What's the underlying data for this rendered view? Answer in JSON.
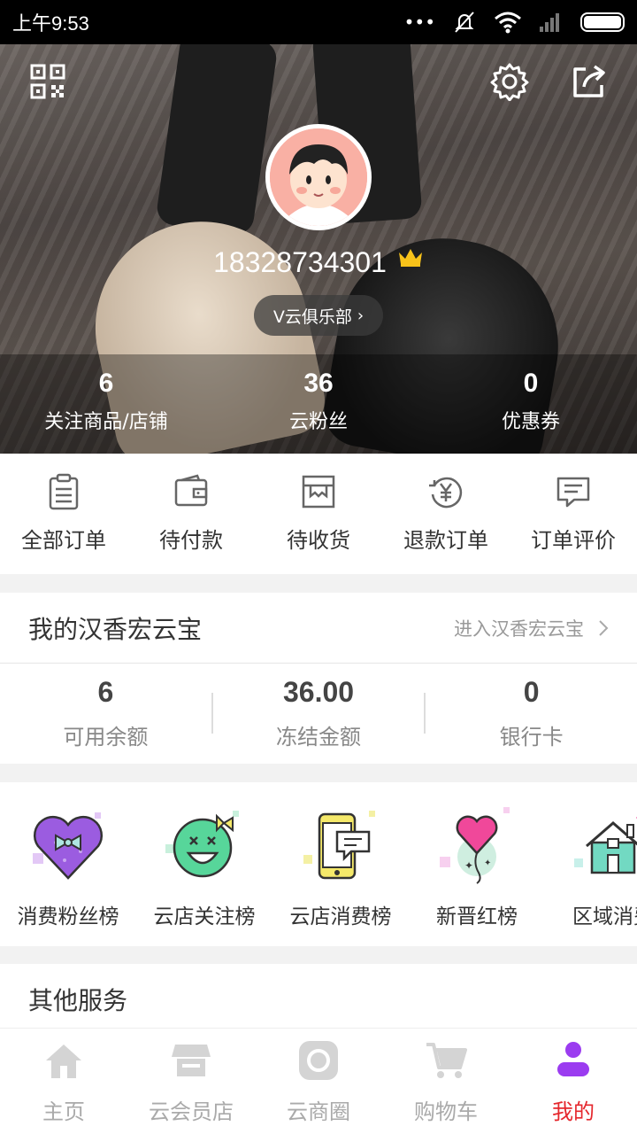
{
  "status_bar": {
    "time": "上午9:53",
    "dots": "•••"
  },
  "profile": {
    "phone": "18328734301",
    "club_label": "V云俱乐部",
    "stats": [
      {
        "value": "6",
        "label": "关注商品/店铺"
      },
      {
        "value": "36",
        "label": "云粉丝"
      },
      {
        "value": "0",
        "label": "优惠券"
      }
    ]
  },
  "orders": [
    {
      "label": "全部订单",
      "icon": "clipboard-icon"
    },
    {
      "label": "待付款",
      "icon": "wallet-icon"
    },
    {
      "label": "待收货",
      "icon": "box-icon"
    },
    {
      "label": "退款订单",
      "icon": "yen-refund-icon"
    },
    {
      "label": "订单评价",
      "icon": "comment-icon"
    }
  ],
  "wallet": {
    "title": "我的汉香宏云宝",
    "enter_label": "进入汉香宏云宝",
    "stats": [
      {
        "value": "6",
        "label": "可用余额"
      },
      {
        "value": "36.00",
        "label": "冻结金额"
      },
      {
        "value": "0",
        "label": "银行卡"
      }
    ]
  },
  "ranks": [
    {
      "label": "消费粉丝榜",
      "icon": "heart-bow-icon"
    },
    {
      "label": "云店关注榜",
      "icon": "smiley-icon"
    },
    {
      "label": "云店消费榜",
      "icon": "phone-chat-icon"
    },
    {
      "label": "新晋红榜",
      "icon": "balloon-icon"
    },
    {
      "label": "区域消费",
      "icon": "house-icon"
    }
  ],
  "other_services": {
    "title": "其他服务"
  },
  "tabbar": [
    {
      "label": "主页",
      "icon": "home-icon"
    },
    {
      "label": "云会员店",
      "icon": "store-icon"
    },
    {
      "label": "云商圈",
      "icon": "circle-icon"
    },
    {
      "label": "购物车",
      "icon": "cart-icon"
    },
    {
      "label": "我的",
      "icon": "user-icon",
      "active": true
    }
  ],
  "colors": {
    "accent": "#e5272d",
    "active_tab_icon": "#9b3cf0"
  }
}
